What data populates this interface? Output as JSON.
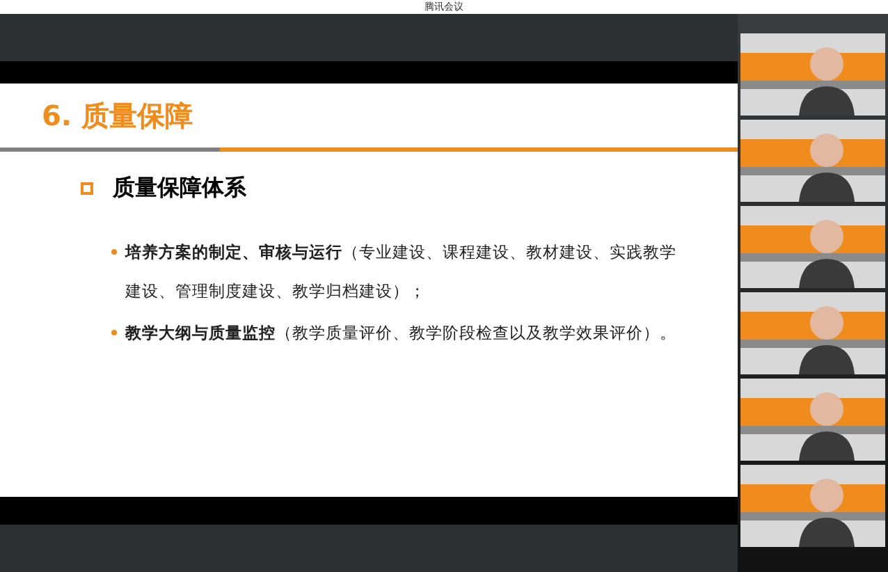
{
  "window": {
    "title": "腾讯会议"
  },
  "slide": {
    "title": "6. 质量保障",
    "heading": "质量保障体系",
    "bullets": [
      {
        "text": "**培养方案的制定、审核与运行**（专业建设、课程建设、教材建设、实践教学建设、管理制度建设、教学归档建设）；"
      },
      {
        "text": "**教学大纲与质量监控**（教学质量评价、教学阶段检查以及教学效果评价）。"
      }
    ]
  },
  "video_tiles": [
    {
      "kind": "camera"
    },
    {
      "kind": "camera"
    },
    {
      "kind": "camera"
    },
    {
      "kind": "camera"
    },
    {
      "kind": "camera"
    },
    {
      "kind": "camera"
    }
  ]
}
